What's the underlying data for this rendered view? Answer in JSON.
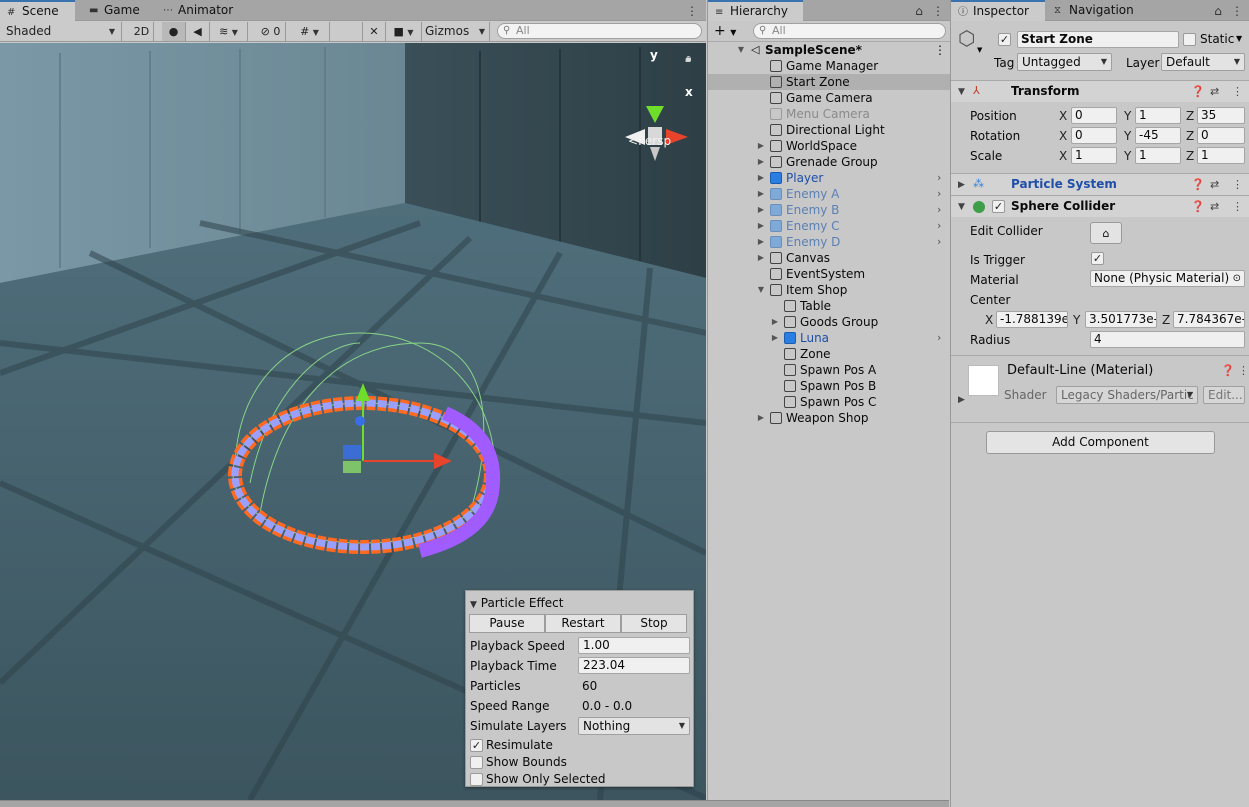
{
  "scene_tabs": [
    {
      "label": "Scene",
      "icon": "grid-icon"
    },
    {
      "label": "Game",
      "icon": "gamepad-icon"
    },
    {
      "label": "Animator",
      "icon": "animator-icon"
    }
  ],
  "toolbar": {
    "shading_mode": "Shaded",
    "toggle_2d": "2D",
    "hidden_count": "0",
    "gizmos": "Gizmos",
    "search_placeholder": "All"
  },
  "viewport": {
    "gizmo_y": "y",
    "gizmo_x": "x",
    "projection": "Persp"
  },
  "particle_effect": {
    "title": "Particle Effect",
    "buttons": [
      "Pause",
      "Restart",
      "Stop"
    ],
    "playback_speed_label": "Playback Speed",
    "playback_speed": "1.00",
    "playback_time_label": "Playback Time",
    "playback_time": "223.04",
    "particles_label": "Particles",
    "particles": "60",
    "speed_range_label": "Speed Range",
    "speed_range": "0.0 - 0.0",
    "simulate_layers_label": "Simulate Layers",
    "simulate_layers": "Nothing",
    "resimulate_label": "Resimulate",
    "resimulate": true,
    "show_bounds_label": "Show Bounds",
    "show_bounds": false,
    "show_only_selected_label": "Show Only Selected",
    "show_only_selected": false
  },
  "hierarchy": {
    "tab": "Hierarchy",
    "search_placeholder": "All",
    "scene": "SampleScene*",
    "items": [
      {
        "label": "Game Manager",
        "indent": 1,
        "arrow": "",
        "style": "normal",
        "chevron": false,
        "selected": false
      },
      {
        "label": "Start Zone",
        "indent": 1,
        "arrow": "",
        "style": "normal",
        "chevron": false,
        "selected": true
      },
      {
        "label": "Game Camera",
        "indent": 1,
        "arrow": "",
        "style": "normal",
        "chevron": false,
        "selected": false
      },
      {
        "label": "Menu Camera",
        "indent": 1,
        "arrow": "",
        "style": "disabled",
        "chevron": false,
        "selected": false
      },
      {
        "label": "Directional Light",
        "indent": 1,
        "arrow": "",
        "style": "normal",
        "chevron": false,
        "selected": false
      },
      {
        "label": "WorldSpace",
        "indent": 1,
        "arrow": "▶",
        "style": "normal",
        "chevron": false,
        "selected": false
      },
      {
        "label": "Grenade Group",
        "indent": 1,
        "arrow": "▶",
        "style": "normal",
        "chevron": false,
        "selected": false
      },
      {
        "label": "Player",
        "indent": 1,
        "arrow": "▶",
        "style": "prefab",
        "chevron": true,
        "selected": false
      },
      {
        "label": "Enemy A",
        "indent": 1,
        "arrow": "▶",
        "style": "prefab-faded",
        "chevron": true,
        "selected": false
      },
      {
        "label": "Enemy B",
        "indent": 1,
        "arrow": "▶",
        "style": "prefab-faded",
        "chevron": true,
        "selected": false
      },
      {
        "label": "Enemy C",
        "indent": 1,
        "arrow": "▶",
        "style": "prefab-faded",
        "chevron": true,
        "selected": false
      },
      {
        "label": "Enemy D",
        "indent": 1,
        "arrow": "▶",
        "style": "prefab-faded",
        "chevron": true,
        "selected": false
      },
      {
        "label": "Canvas",
        "indent": 1,
        "arrow": "▶",
        "style": "normal",
        "chevron": false,
        "selected": false
      },
      {
        "label": "EventSystem",
        "indent": 1,
        "arrow": "",
        "style": "normal",
        "chevron": false,
        "selected": false
      },
      {
        "label": "Item Shop",
        "indent": 1,
        "arrow": "▼",
        "style": "normal",
        "chevron": false,
        "selected": false
      },
      {
        "label": "Table",
        "indent": 2,
        "arrow": "",
        "style": "normal",
        "chevron": false,
        "selected": false
      },
      {
        "label": "Goods Group",
        "indent": 2,
        "arrow": "▶",
        "style": "normal",
        "chevron": false,
        "selected": false
      },
      {
        "label": "Luna",
        "indent": 2,
        "arrow": "▶",
        "style": "prefab",
        "chevron": true,
        "selected": false
      },
      {
        "label": "Zone",
        "indent": 2,
        "arrow": "",
        "style": "normal",
        "chevron": false,
        "selected": false
      },
      {
        "label": "Spawn Pos A",
        "indent": 2,
        "arrow": "",
        "style": "normal",
        "chevron": false,
        "selected": false
      },
      {
        "label": "Spawn Pos B",
        "indent": 2,
        "arrow": "",
        "style": "normal",
        "chevron": false,
        "selected": false
      },
      {
        "label": "Spawn Pos C",
        "indent": 2,
        "arrow": "",
        "style": "normal",
        "chevron": false,
        "selected": false
      },
      {
        "label": "Weapon Shop",
        "indent": 1,
        "arrow": "▶",
        "style": "normal",
        "chevron": false,
        "selected": false
      }
    ]
  },
  "inspector": {
    "tabs": [
      "Inspector",
      "Navigation"
    ],
    "object_name": "Start Zone",
    "object_active": true,
    "static_label": "Static",
    "tag_label": "Tag",
    "tag": "Untagged",
    "layer_label": "Layer",
    "layer": "Default",
    "transform": {
      "title": "Transform",
      "position_label": "Position",
      "position": {
        "x": "0",
        "y": "1",
        "z": "35"
      },
      "rotation_label": "Rotation",
      "rotation": {
        "x": "0",
        "y": "-45",
        "z": "0"
      },
      "scale_label": "Scale",
      "scale": {
        "x": "1",
        "y": "1",
        "z": "1"
      }
    },
    "particle_system": {
      "title": "Particle System"
    },
    "sphere_collider": {
      "title": "Sphere Collider",
      "enabled": true,
      "edit_collider_label": "Edit Collider",
      "is_trigger_label": "Is Trigger",
      "is_trigger": true,
      "material_label": "Material",
      "material": "None (Physic Material)",
      "center_label": "Center",
      "center": {
        "x": "-1.788139e-",
        "y": "3.501773e-",
        "z": "7.784367e-"
      },
      "radius_label": "Radius",
      "radius": "4"
    },
    "material": {
      "title": "Default-Line (Material)",
      "shader_label": "Shader",
      "shader": "Legacy Shaders/Partic",
      "edit_label": "Edit..."
    },
    "add_component": "Add Component",
    "axis_x": "X",
    "axis_y": "Y",
    "axis_z": "Z"
  }
}
